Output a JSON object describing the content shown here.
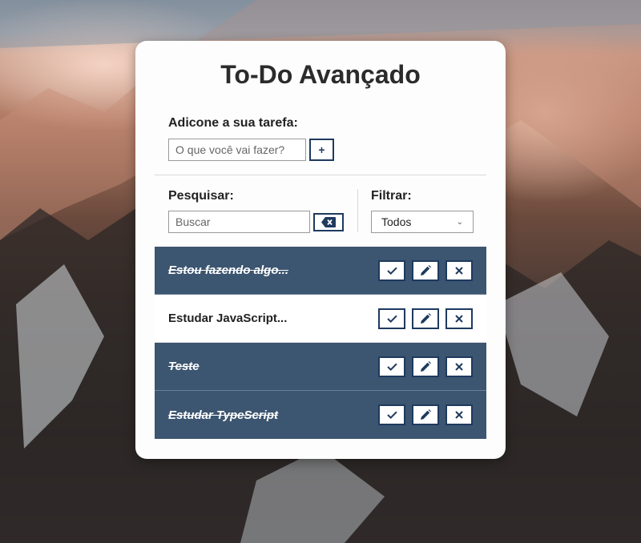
{
  "app": {
    "title": "To-Do Avançado"
  },
  "add": {
    "label": "Adicone a sua tarefa:",
    "placeholder": "O que você vai fazer?",
    "button": "+"
  },
  "search": {
    "label": "Pesquisar:",
    "placeholder": "Buscar"
  },
  "filter": {
    "label": "Filtrar:",
    "selected": "Todos"
  },
  "todos": [
    {
      "text": "Estou fazendo algo...",
      "done": true
    },
    {
      "text": "Estudar JavaScript...",
      "done": false
    },
    {
      "text": "Teste",
      "done": true
    },
    {
      "text": "Estudar TypeScript",
      "done": true
    }
  ],
  "icons": {
    "finish": "check-icon",
    "edit": "pencil-icon",
    "remove": "close-icon",
    "erase": "backspace-icon"
  },
  "colors": {
    "accent": "#1e3a5f",
    "done_bg": "#3c5570"
  }
}
